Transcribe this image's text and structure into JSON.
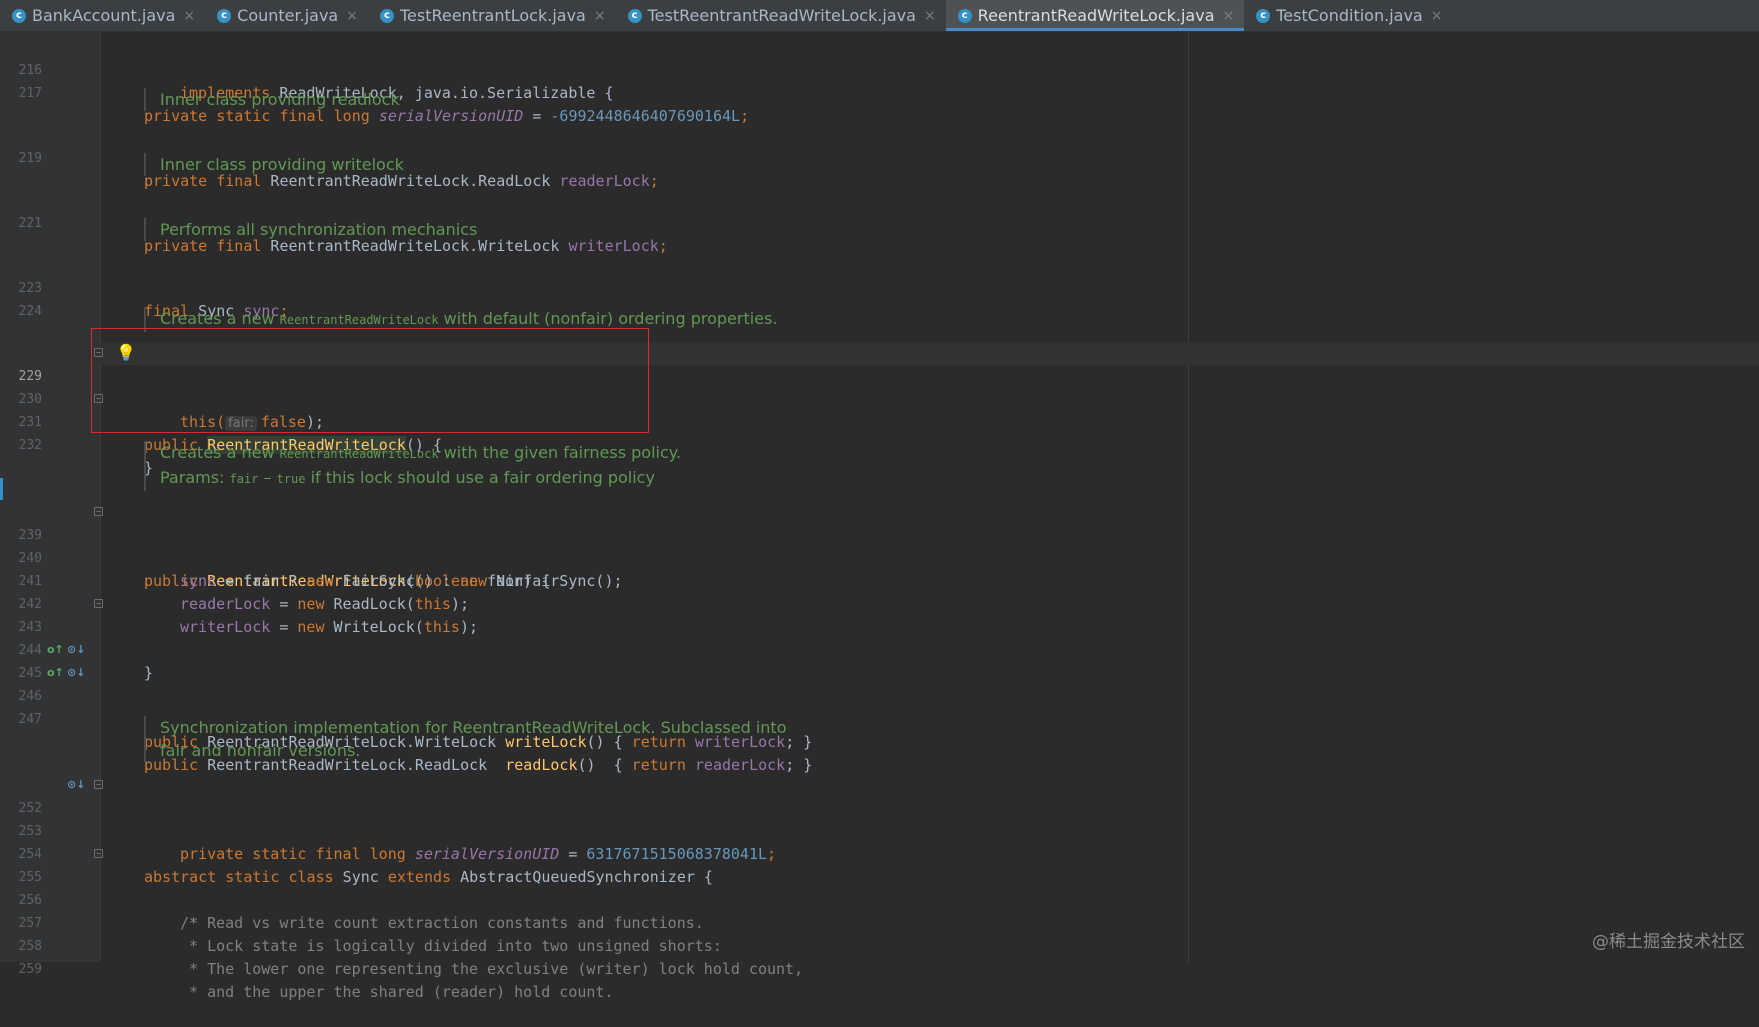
{
  "tabs": [
    {
      "label": "BankAccount.java",
      "active": false
    },
    {
      "label": "Counter.java",
      "active": false
    },
    {
      "label": "TestReentrantLock.java",
      "active": false
    },
    {
      "label": "TestReentrantReadWriteLock.java",
      "active": false
    },
    {
      "label": "ReentrantReadWriteLock.java",
      "active": true
    },
    {
      "label": "TestCondition.java",
      "active": false
    }
  ],
  "close_glyph": "×",
  "line_numbers": {
    "l216": "216",
    "l217": "217",
    "l219": "219",
    "l221": "221",
    "l223": "223",
    "l224": "224",
    "l229": "229",
    "l230": "230",
    "l231": "231",
    "l232": "232",
    "l239": "239",
    "l240": "240",
    "l241": "241",
    "l242": "242",
    "l243": "243",
    "l244": "244",
    "l245": "245",
    "l246": "246",
    "l247": "247",
    "l252": "252",
    "l253": "253",
    "l254": "254",
    "l255": "255",
    "l256": "256",
    "l257": "257",
    "l258": "258",
    "l259": "259"
  },
  "docs": {
    "readlock": "Inner class providing readlock",
    "writelock": "Inner class providing writelock",
    "sync": "Performs all synchronization mechanics",
    "ctor_default_pre": "Creates a new ",
    "ctor_default_code": "ReentrantReadWriteLock",
    "ctor_default_post": " with default (nonfair) ordering properties.",
    "ctor_fair_pre": "Creates a new ",
    "ctor_fair_code": "ReentrantReadWriteLock",
    "ctor_fair_post": " with the given fairness policy.",
    "params_pre": "Params: ",
    "params_code1": "fair",
    "params_dash": " – ",
    "params_code2": "true",
    "params_post": " if this lock should use a fair ordering policy",
    "sync_impl_1": "Synchronization implementation for ReentrantReadWriteLock. Subclassed into",
    "sync_impl_2": "fair and nonfair versions."
  },
  "code": {
    "l216_kw": "implements",
    "l216_rest": " ReadWriteLock, java.io.Serializable {",
    "l217_kw": "private static final long",
    "l217_field": "serialVersionUID",
    "l217_eq": " = ",
    "l217_num": "-6992448646407690164L",
    "l217_end": ";",
    "l219_kw": "private final",
    "l219_type": " ReentrantReadWriteLock.ReadLock ",
    "l219_field": "readerLock",
    "l219_end": ";",
    "l221_kw": "private final",
    "l221_type": " ReentrantReadWriteLock.WriteLock ",
    "l221_field": "writerLock",
    "l221_end": ";",
    "l223_kw": "final",
    "l223_type": " Sync ",
    "l223_field": "sync",
    "l223_end": ";",
    "l229_kw": "public",
    "l229_name": "ReentrantReadWriteLock",
    "l229_end": "() {",
    "l230_this": "this(",
    "l230_hint": "fair:",
    "l230_kw": "false",
    "l230_end": ");",
    "l231": "}",
    "l239_kw": "public",
    "l239_name": "ReentrantReadWriteLock",
    "l239_open": "(",
    "l239_kw2": "boolean",
    "l239_rest": " fair) {",
    "l240_field": "sync",
    "l240_a": " = fair ? ",
    "l240_kw1": "new",
    "l240_b": " FairSync() : ",
    "l240_kw2": "new",
    "l240_c": " NonfairSync();",
    "l241_field": "readerLock",
    "l241_a": " = ",
    "l241_kw": "new",
    "l241_b": " ReadLock(",
    "l241_kw2": "this",
    "l241_c": ");",
    "l242_field": "writerLock",
    "l242_a": " = ",
    "l242_kw": "new",
    "l242_b": " WriteLock(",
    "l242_kw2": "this",
    "l242_c": ");",
    "l243": "}",
    "l245_kw": "public",
    "l245_type": " ReentrantReadWriteLock.WriteLock ",
    "l245_fn": "writeLock",
    "l245_a": "() { ",
    "l245_kw2": "return",
    "l245_sp": " ",
    "l245_field": "writerLock",
    "l245_end": "; }",
    "l246_kw": "public",
    "l246_type": " ReentrantReadWriteLock.ReadLock  ",
    "l246_fn": "readLock",
    "l246_a": "()  { ",
    "l246_kw2": "return",
    "l246_sp": " ",
    "l246_field": "readerLock",
    "l246_end": "; }",
    "l252_kw": "abstract static class",
    "l252_a": " Sync ",
    "l252_kw2": "extends",
    "l252_b": " AbstractQueuedSynchronizer {",
    "l253_kw": "private static final long",
    "l253_field": "serialVersionUID",
    "l253_eq": " = ",
    "l253_num": "6317671515068378041L",
    "l253_end": ";",
    "l255": "/*",
    "l256": " * Read vs write count extraction constants and functions.",
    "l257": " * Lock state is logically divided into two unsigned shorts:",
    "l258": " * The lower one representing the exclusive (writer) lock hold count,",
    "l259": " * and the upper the shared (reader) hold count."
  },
  "gutter_icons": {
    "c_glyph": "c",
    "override_glyph": "o↑",
    "impl_glyph": "⊙↓",
    "bulb": "💡",
    "fold_glyph": "−"
  },
  "watermark": "@稀土掘金技术社区",
  "colors": {
    "background": "#2b2b2b",
    "keyword": "#cc7832",
    "field": "#9876aa",
    "number": "#6897bb",
    "doc": "#629755",
    "method": "#ffc66d",
    "highlight_box": "#d32f2f"
  }
}
